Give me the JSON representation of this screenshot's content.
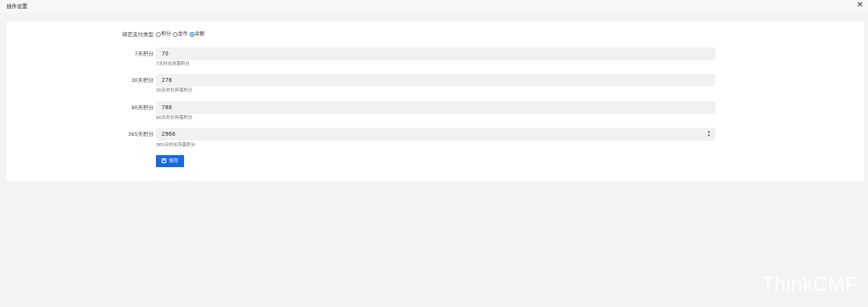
{
  "header": {
    "title": "插件设置",
    "close_symbol": "✕"
  },
  "form": {
    "pay_type": {
      "label": "绑定支付类型",
      "options": [
        {
          "label": "积分",
          "checked": false
        },
        {
          "label": "金币",
          "checked": false
        },
        {
          "label": "余额",
          "checked": true
        }
      ]
    },
    "fields": [
      {
        "label": "7天积分",
        "value": "70",
        "help": "7天时长所需积分"
      },
      {
        "label": "30天积分",
        "value": "278",
        "help": "30天时长所需积分"
      },
      {
        "label": "90天积分",
        "value": "788",
        "help": "90天时长所需积分"
      },
      {
        "label": "365天积分",
        "value": "2966",
        "help": "365天时长所需积分"
      }
    ],
    "save_label": "保存"
  },
  "watermark": "ThinkCMF",
  "colors": {
    "primary": "#1668e3",
    "page_bg": "#f2f3f5",
    "input_bg": "#f1f1f3"
  }
}
